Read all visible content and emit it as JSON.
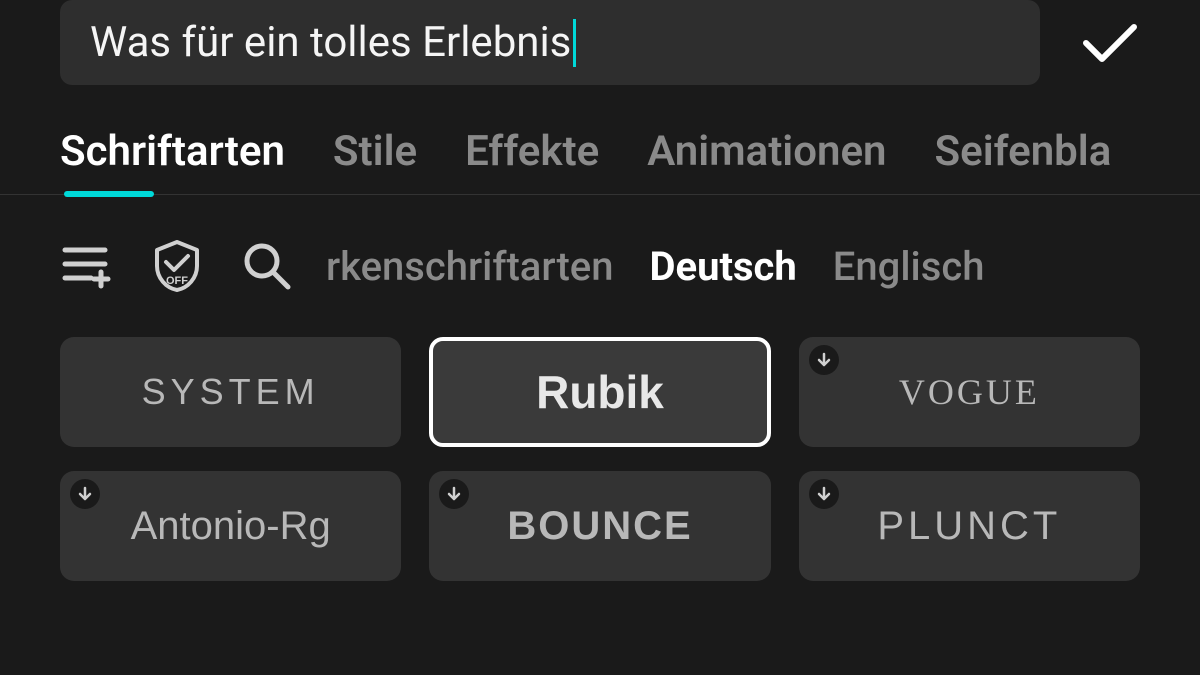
{
  "input": {
    "text": "Was für ein tolles Erlebnis"
  },
  "tabs": [
    {
      "label": "Schriftarten",
      "active": true
    },
    {
      "label": "Stile",
      "active": false
    },
    {
      "label": "Effekte",
      "active": false
    },
    {
      "label": "Animationen",
      "active": false
    },
    {
      "label": "Seifenbla",
      "active": false
    }
  ],
  "filter": {
    "partial_category": "rkenschriftarten",
    "languages": [
      {
        "label": "Deutsch",
        "active": true
      },
      {
        "label": "Englisch",
        "active": false
      }
    ]
  },
  "fonts": [
    {
      "name": "SYSTEM",
      "selected": false,
      "download": false,
      "style": "f-system"
    },
    {
      "name": "Rubik",
      "selected": true,
      "download": false,
      "style": "f-rubik"
    },
    {
      "name": "VOGUE",
      "selected": false,
      "download": true,
      "style": "f-vogue"
    },
    {
      "name": "Antonio-Rg",
      "selected": false,
      "download": true,
      "style": "f-antonio"
    },
    {
      "name": "BOUNCE",
      "selected": false,
      "download": true,
      "style": "f-bounce"
    },
    {
      "name": "PLUNCT",
      "selected": false,
      "download": true,
      "style": "f-plunct"
    }
  ],
  "colors": {
    "accent": "#00d9d9",
    "bg": "#1a1a1a",
    "tile": "#333333"
  }
}
